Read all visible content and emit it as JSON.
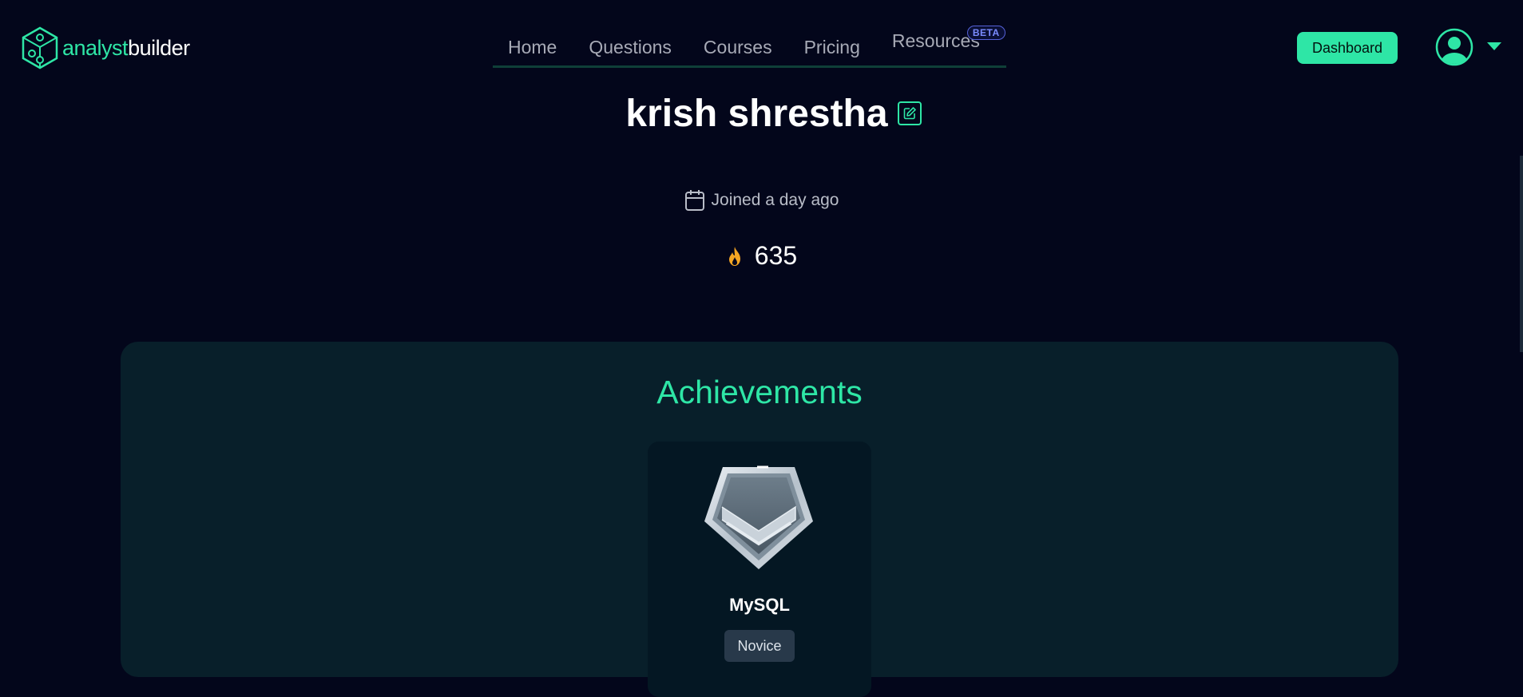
{
  "brand": {
    "logo_part1": "analyst",
    "logo_part2": "builder",
    "accent_color": "#2ee6a6",
    "background_color": "#03061b"
  },
  "nav": {
    "items": [
      "Home",
      "Questions",
      "Courses",
      "Pricing",
      "Resources"
    ],
    "beta_badge": "BETA"
  },
  "header": {
    "dashboard_label": "Dashboard",
    "avatar_icon": "user-circle-icon",
    "menu_icon": "chevron-down-icon"
  },
  "profile": {
    "name": "krish shrestha",
    "edit_icon": "edit-icon",
    "joined": "Joined a day ago",
    "calendar_icon": "calendar-icon",
    "streak_icon": "flame-icon",
    "streak_value": "635"
  },
  "achievements": {
    "title": "Achievements",
    "items": [
      {
        "name": "MySQL",
        "level": "Novice",
        "badge_icon": "silver-rank-badge-icon"
      }
    ]
  }
}
